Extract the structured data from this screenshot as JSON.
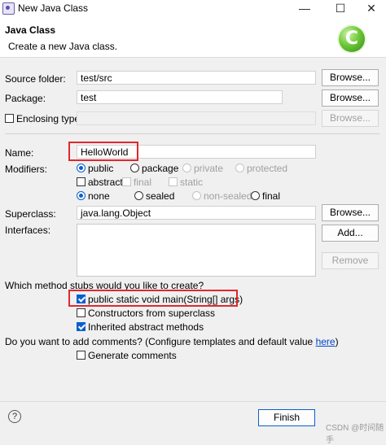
{
  "window": {
    "title": "New Java Class"
  },
  "header": {
    "title": "Java Class",
    "description": "Create a new Java class."
  },
  "form": {
    "source_folder": {
      "label": "Source folder:",
      "value": "test/src",
      "button": "Browse..."
    },
    "package": {
      "label": "Package:",
      "value": "test",
      "button": "Browse..."
    },
    "enclosing_type": {
      "label": "Enclosing type:",
      "value": "",
      "button": "Browse...",
      "checked": false
    },
    "name": {
      "label": "Name:",
      "value": "HelloWorld"
    },
    "modifiers": {
      "label": "Modifiers:",
      "access": [
        "public",
        "package",
        "private",
        "protected"
      ],
      "access_selected": "public",
      "flags": [
        "abstract",
        "final",
        "static"
      ],
      "sealed_opts": [
        "none",
        "sealed",
        "non-sealed",
        "final"
      ],
      "sealed_selected": "none"
    },
    "superclass": {
      "label": "Superclass:",
      "value": "java.lang.Object",
      "button": "Browse..."
    },
    "interfaces": {
      "label": "Interfaces:",
      "add_button": "Add...",
      "remove_button": "Remove"
    },
    "stubs": {
      "question": "Which method stubs would you like to create?",
      "main": {
        "label": "public static void main(String[] args)",
        "checked": true
      },
      "constructors": {
        "label": "Constructors from superclass",
        "checked": false
      },
      "inherited": {
        "label": "Inherited abstract methods",
        "checked": true
      }
    },
    "comments": {
      "question": "Do you want to add comments? (Configure templates and default value ",
      "link": "here",
      "suffix": ")",
      "generate": {
        "label": "Generate comments",
        "checked": false
      }
    }
  },
  "footer": {
    "finish": "Finish",
    "help_icon": "?",
    "watermark": "CSDN @时间随手"
  },
  "colors": {
    "accent": "#0a5fcf",
    "highlight": "#e0282f",
    "logo": "#4caf2a"
  },
  "window_controls": [
    "—",
    "☐",
    "✕"
  ],
  "logo_letter": "C"
}
